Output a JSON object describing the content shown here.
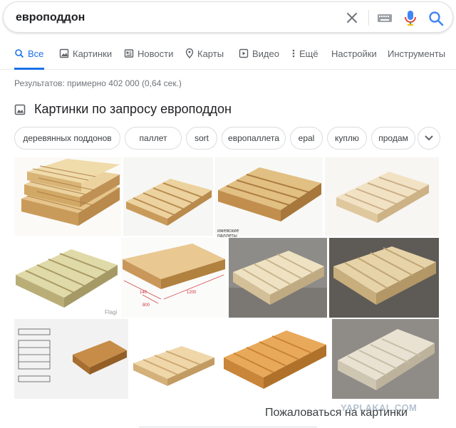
{
  "search": {
    "query": "европоддон"
  },
  "tabs": [
    {
      "label": "Все",
      "icon": "search-icon",
      "active": true
    },
    {
      "label": "Картинки",
      "icon": "image-icon"
    },
    {
      "label": "Новости",
      "icon": "news-icon"
    },
    {
      "label": "Карты",
      "icon": "map-pin-icon"
    },
    {
      "label": "Видео",
      "icon": "video-icon"
    },
    {
      "label": "Ещё",
      "icon": "more-vert-icon"
    },
    {
      "label": "Настройки"
    },
    {
      "label": "Инструменты"
    }
  ],
  "stats": "Результатов: примерно 402 000 (0,64 сек.)",
  "images_section": {
    "title": "Картинки по запросу европоддон",
    "chips": [
      "деревянных поддонов",
      "паллет",
      "sort",
      "европаллета",
      "epal",
      "куплю",
      "продам"
    ],
    "thumb_captions": [
      "Flagi",
      "ижевские паллеты"
    ]
  },
  "footer": {
    "report_link": "Пожаловаться на картинки",
    "watermark": "YAPLAKAL.COM"
  },
  "colors": {
    "accent": "#1a73e8",
    "wood_light": "#e8cf9c",
    "wood_mid": "#d9b477",
    "wood_dark": "#b98a4c"
  }
}
